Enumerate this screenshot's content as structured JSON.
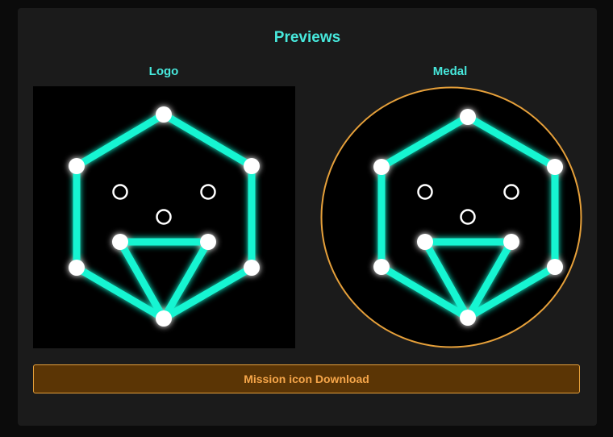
{
  "previews": {
    "title": "Previews",
    "logo_label": "Logo",
    "medal_label": "Medal",
    "download_label": "Mission icon Download"
  },
  "colors": {
    "panel_background": "#1b1b1b",
    "accent_text": "#47e8dc",
    "glyph_line": "#14f5d2",
    "glyph_dot": "#ffffff",
    "medal_ring": "#e6a03a",
    "button_background": "#5b3505",
    "button_text": "#f6a64a"
  },
  "icons": {
    "logo": "ingress-glyph-icon",
    "medal": "ingress-glyph-medal-icon"
  }
}
